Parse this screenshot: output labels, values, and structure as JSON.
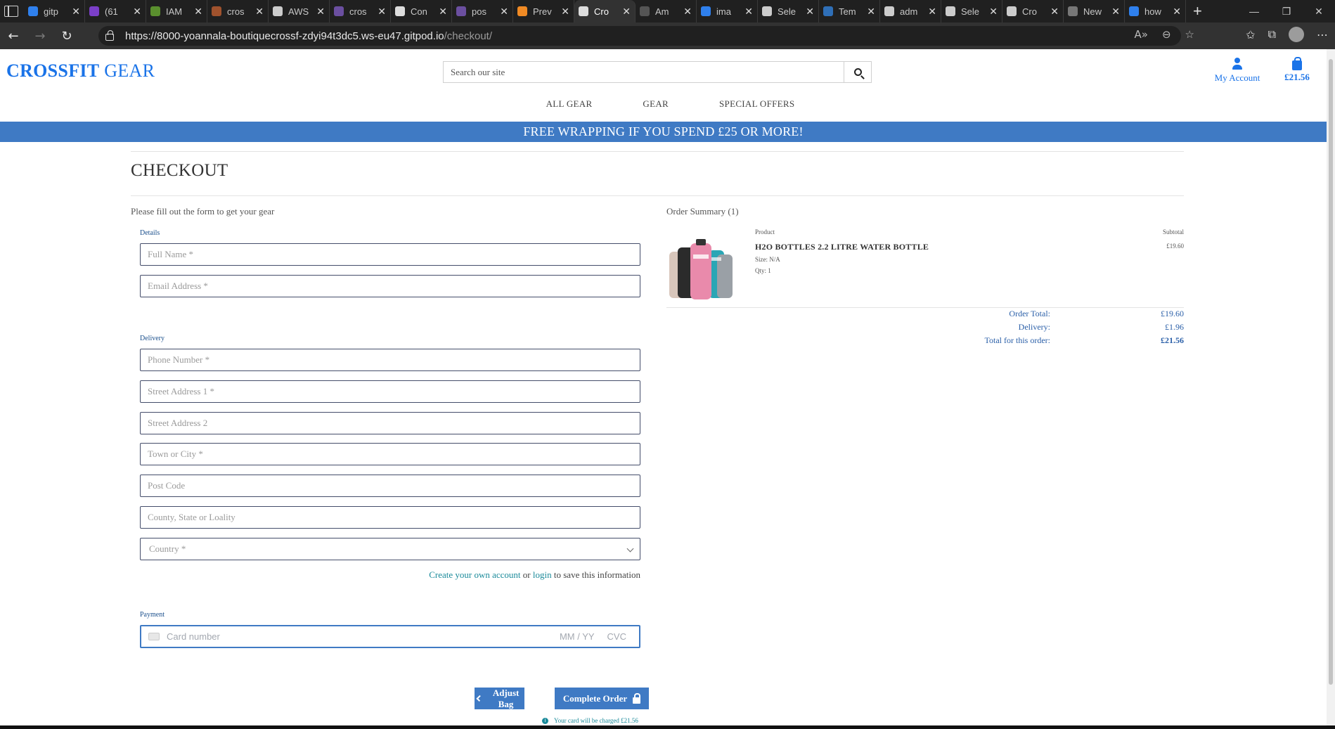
{
  "browser": {
    "tabs": [
      {
        "label": "gitp",
        "color": "#2f80ed"
      },
      {
        "label": "(61",
        "color": "#7b3fc8"
      },
      {
        "label": "IAM",
        "color": "#5a8f2e"
      },
      {
        "label": "cros",
        "color": "#a0522d"
      },
      {
        "label": "AWS",
        "color": "#cccccc"
      },
      {
        "label": "cros",
        "color": "#6b4fa0"
      },
      {
        "label": "Con",
        "color": "#dddddd"
      },
      {
        "label": "pos",
        "color": "#6b4fa0"
      },
      {
        "label": "Prev",
        "color": "#f08a24"
      },
      {
        "label": "Cro",
        "color": "#dddddd",
        "active": true
      },
      {
        "label": "Am",
        "color": "#555555"
      },
      {
        "label": "ima",
        "color": "#2f80ed"
      },
      {
        "label": "Sele",
        "color": "#cccccc"
      },
      {
        "label": "Tem",
        "color": "#2f6fb7"
      },
      {
        "label": "adm",
        "color": "#cccccc"
      },
      {
        "label": "Sele",
        "color": "#cccccc"
      },
      {
        "label": "Cro",
        "color": "#cccccc"
      },
      {
        "label": "New",
        "color": "#777777"
      },
      {
        "label": "how",
        "color": "#2f80ed"
      }
    ],
    "url_host": "https://8000-yoannala-boutiquecrossf-zdyi94t3dc5.ws-eu47.gitpod.io",
    "url_path": "/checkout/"
  },
  "site": {
    "logo_bold": "CROSSFIT",
    "logo_rest": " GEAR",
    "search_placeholder": "Search our site",
    "account_label": "My Account",
    "bag_total": "£21.56",
    "nav": [
      "ALL GEAR",
      "GEAR",
      "SPECIAL OFFERS"
    ],
    "banner": "FREE WRAPPING IF YOU SPEND £25 OR MORE!"
  },
  "checkout": {
    "title": "CHECKOUT",
    "intro": "Please fill out the form to get your gear",
    "details_legend": "Details",
    "full_name_placeholder": "Full Name *",
    "email_placeholder": "Email Address *",
    "delivery_legend": "Delivery",
    "phone_placeholder": "Phone Number *",
    "street1_placeholder": "Street Address 1 *",
    "street2_placeholder": "Street Address 2",
    "town_placeholder": "Town or City *",
    "postcode_placeholder": "Post Code",
    "county_placeholder": "County, State or Loality",
    "country_selected": "Country *",
    "create_account_link": "Create your own account",
    "or_text": " or ",
    "login_link": "login",
    "save_text": " to save this information",
    "payment_legend": "Payment",
    "card_placeholder": "Card number",
    "card_exp_placeholder": "MM / YY",
    "card_cvc_placeholder": "CVC",
    "adjust_bag": "Adjust Bag",
    "complete_order": "Complete Order",
    "charge_note": "Your card will be charged £21.56"
  },
  "summary": {
    "title": "Order Summary (1)",
    "product_header": "Product",
    "subtotal_header": "Subtotal",
    "item": {
      "name": "H2O BOTTLES 2.2 LITRE WATER BOTTLE",
      "size": "Size: N/A",
      "qty": "Qty: 1",
      "subtotal": "£19.60"
    },
    "order_total_label": "Order Total:",
    "order_total": "£19.60",
    "delivery_label": "Delivery:",
    "delivery": "£1.96",
    "grand_total_label": "Total for this order:",
    "grand_total": "£21.56"
  },
  "colors": {
    "brand_blue": "#1a73e8",
    "banner_blue": "#3f7ac4",
    "link_teal": "#1a8a9a"
  }
}
